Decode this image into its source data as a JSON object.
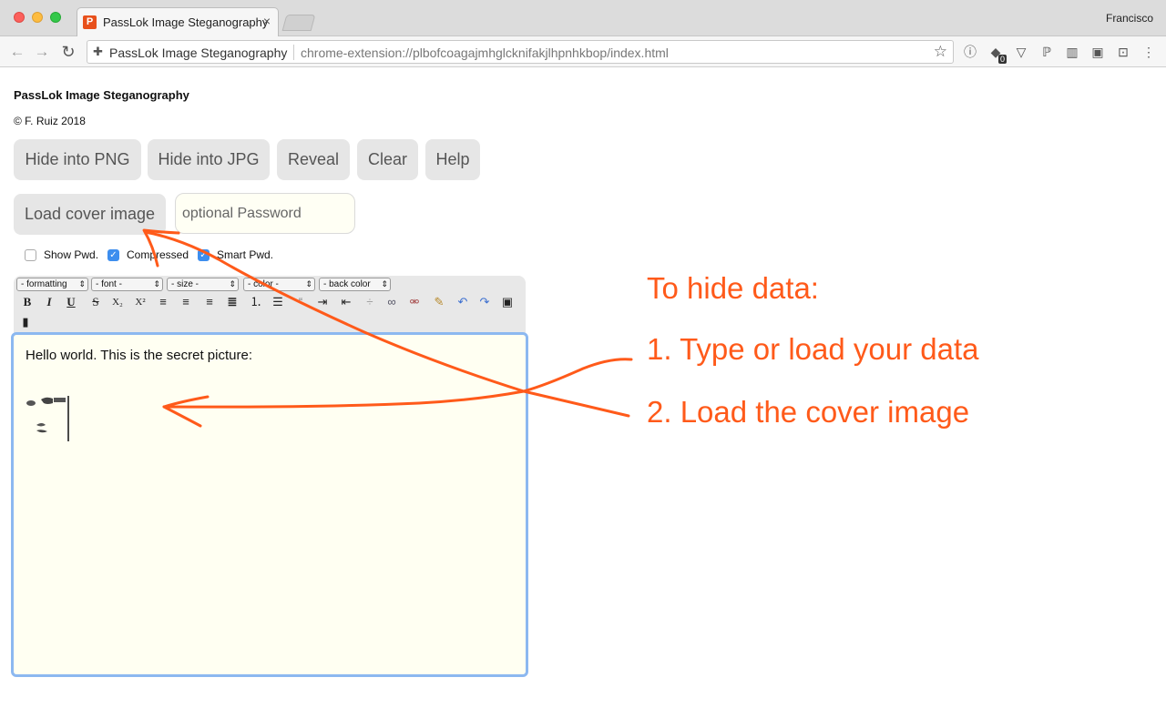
{
  "browser": {
    "tab_title": "PassLok Image Steganography",
    "tab_favicon": "P",
    "tab_close": "×",
    "profile_name": "Francisco",
    "omnibox_site": "PassLok Image Steganography",
    "url": "chrome-extension://plbofcoagajmhglcknifakjlhpnhkbop/index.html",
    "extension_badge": "0"
  },
  "app": {
    "title": "PassLok Image Steganography",
    "copyright": "© F. Ruiz 2018"
  },
  "buttons": {
    "hide_png": "Hide into PNG",
    "hide_jpg": "Hide into JPG",
    "reveal": "Reveal",
    "clear": "Clear",
    "help": "Help",
    "load_cover": "Load cover image"
  },
  "password": {
    "placeholder": "optional Password"
  },
  "checkboxes": [
    {
      "label": "Show Pwd.",
      "checked": false
    },
    {
      "label": "Compressed",
      "checked": true
    },
    {
      "label": "Smart Pwd.",
      "checked": true
    }
  ],
  "editor_toolbar": {
    "selects": [
      "- formatting",
      "- font -",
      "- size -",
      "- color -",
      "- back color"
    ],
    "icons": [
      "bold-icon",
      "italic-icon",
      "underline-icon",
      "strikethrough-icon",
      "subscript-icon",
      "superscript-icon",
      "align-left-icon",
      "align-center-icon",
      "align-right-icon",
      "justify-icon",
      "numbered-list-icon",
      "bulleted-list-icon",
      "quote-icon",
      "indent-icon",
      "outdent-icon",
      "horizontal-rule-icon",
      "link-icon",
      "unlink-icon",
      "clear-formatting-icon",
      "undo-icon",
      "redo-icon",
      "insert-image-icon",
      "insert-file-icon"
    ]
  },
  "editor": {
    "text": "Hello world. This is the secret picture:"
  },
  "annotation": {
    "heading": "To hide data:",
    "step1": "1. Type or load your data",
    "step2": "2. Load the cover image",
    "color": "#ff5a1a"
  }
}
